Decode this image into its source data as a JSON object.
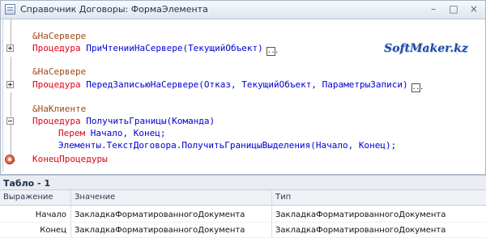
{
  "window": {
    "title": "Справочник Договоры: ФормаЭлемента",
    "buttons": {
      "minimize": "–",
      "maximize": "□",
      "close": "×"
    }
  },
  "brand": "SoftMaker.kz",
  "code": {
    "block1": {
      "directive": "&НаСервере",
      "keyword": "Процедура",
      "signature": "ПриЧтенииНаСервере(ТекущийОбъект)",
      "ellipsis": "..."
    },
    "block2": {
      "directive": "&НаСервере",
      "keyword": "Процедура",
      "signature": "ПередЗаписьюНаСервере(Отказ, ТекущийОбъект, ПараметрыЗаписи)",
      "ellipsis": "..."
    },
    "block3": {
      "directive": "&НаКлиенте",
      "keyword": "Процедура",
      "signature": "ПолучитьГраницы(Команда)",
      "var_keyword": "Перем",
      "var_names": "Начало, Конец;",
      "statement": "Элементы.ТекстДоговора.ПолучитьГраницыВыделения(Начало, Конец);",
      "end_keyword": "КонецПроцедуры"
    }
  },
  "panel": {
    "title": "Табло - 1",
    "columns": [
      "Выражение",
      "Значение",
      "Тип"
    ],
    "rows": [
      {
        "expr": "Начало",
        "value": "ЗакладкаФорматированногоДокумента",
        "type": "ЗакладкаФорматированногоДокумента"
      },
      {
        "expr": "Конец",
        "value": "ЗакладкаФорматированногоДокумента",
        "type": "ЗакладкаФорматированногоДокумента"
      }
    ]
  }
}
